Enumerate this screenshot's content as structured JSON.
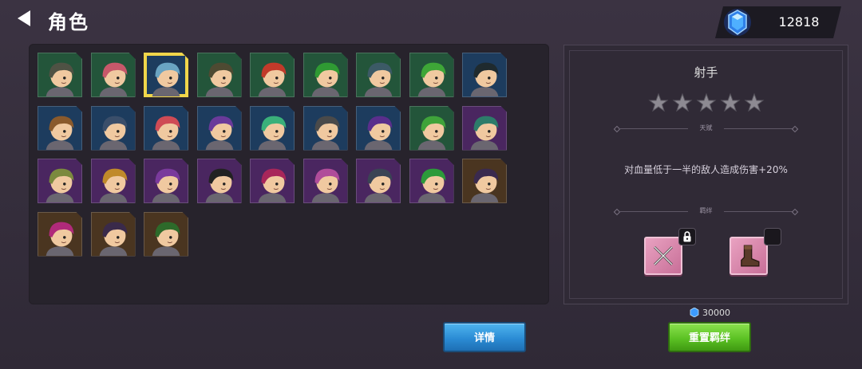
{
  "header": {
    "title": "角色"
  },
  "currency": {
    "gems": "12818",
    "gem_icon": "blue-gem-icon"
  },
  "roster": {
    "slots": [
      {
        "bg": "green",
        "hair": "#4f5244",
        "selected": false
      },
      {
        "bg": "green",
        "hair": "#c7586a",
        "selected": false
      },
      {
        "bg": "blue",
        "hair": "#6aa4c2",
        "selected": true
      },
      {
        "bg": "green",
        "hair": "#4e4a32",
        "selected": false
      },
      {
        "bg": "green",
        "hair": "#c13a2a",
        "selected": false
      },
      {
        "bg": "green",
        "hair": "#2f9a33",
        "selected": false
      },
      {
        "bg": "green",
        "hair": "#3c5a66",
        "selected": false
      },
      {
        "bg": "green",
        "hair": "#3ea637",
        "selected": false
      },
      {
        "bg": "blue",
        "hair": "#1f2a2e",
        "selected": false
      },
      {
        "bg": "blue",
        "hair": "#8a5a2c",
        "selected": false
      },
      {
        "bg": "blue",
        "hair": "#3a4e6a",
        "selected": false
      },
      {
        "bg": "blue",
        "hair": "#cf4b55",
        "selected": false
      },
      {
        "bg": "blue",
        "hair": "#6a3a9a",
        "selected": false
      },
      {
        "bg": "blue",
        "hair": "#3ab07a",
        "selected": false
      },
      {
        "bg": "blue",
        "hair": "#4a4a4a",
        "selected": false
      },
      {
        "bg": "blue",
        "hair": "#5a2e8c",
        "selected": false
      },
      {
        "bg": "green",
        "hair": "#3fa33a",
        "selected": false
      },
      {
        "bg": "purple",
        "hair": "#2d7c6a",
        "selected": false
      },
      {
        "bg": "purple",
        "hair": "#7b8a3e",
        "selected": false
      },
      {
        "bg": "purple",
        "hair": "#c08a2a",
        "selected": false
      },
      {
        "bg": "purple",
        "hair": "#7a3a9c",
        "selected": false
      },
      {
        "bg": "purple",
        "hair": "#222222",
        "selected": false
      },
      {
        "bg": "purple",
        "hair": "#a8265a",
        "selected": false
      },
      {
        "bg": "purple",
        "hair": "#b04c9a",
        "selected": false
      },
      {
        "bg": "purple",
        "hair": "#3a4454",
        "selected": false
      },
      {
        "bg": "purple",
        "hair": "#2c9a3a",
        "selected": false
      },
      {
        "bg": "brown",
        "hair": "#3a2a4e",
        "selected": false
      },
      {
        "bg": "brown",
        "hair": "#b02a7a",
        "selected": false
      },
      {
        "bg": "brown",
        "hair": "#3a2a4a",
        "selected": false
      },
      {
        "bg": "brown",
        "hair": "#2d6a2a",
        "selected": false
      }
    ]
  },
  "detail": {
    "name": "射手",
    "stars": 5,
    "talent_label": "天赋",
    "talent_desc": "对血量低于一半的敌人造成伤害+20%",
    "bond_label": "羁绊",
    "bonds": [
      {
        "icon": "crossed-blades-icon",
        "badge": "lock-icon"
      },
      {
        "icon": "boot-icon",
        "badge": "empty"
      }
    ]
  },
  "actions": {
    "detail_label": "详情",
    "reset_label": "重置羁绊",
    "reset_cost": "30000"
  },
  "colors": {
    "slot_green": "#23553a",
    "slot_blue": "#1d3c5e",
    "slot_purple": "#4a2660",
    "slot_brown": "#4a3520",
    "select_gold": "#f1d64a"
  }
}
